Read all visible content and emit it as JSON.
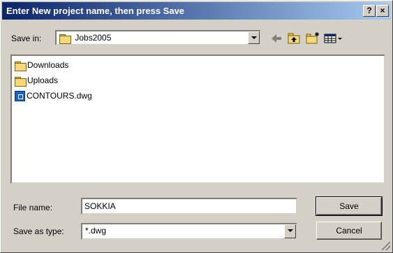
{
  "dialog": {
    "title": "Enter New project name, then press Save",
    "help_label": "?",
    "close_label": "×"
  },
  "toolbar": {
    "save_in_label": "Save in:",
    "save_in_value": "Jobs2005",
    "back_icon": "back-arrow-icon",
    "up_icon": "up-one-level-icon",
    "new_folder_icon": "new-folder-icon",
    "view_menu_icon": "view-menu-icon"
  },
  "files": [
    {
      "name": "Downloads",
      "type": "folder"
    },
    {
      "name": "Uploads",
      "type": "folder"
    },
    {
      "name": "CONTOURS.dwg",
      "type": "dwg"
    }
  ],
  "form": {
    "file_name_label": "File name:",
    "file_name_value": "SOKKIA",
    "save_as_type_label": "Save as type:",
    "save_as_type_value": "*.dwg"
  },
  "buttons": {
    "save": "Save",
    "cancel": "Cancel"
  },
  "colors": {
    "title_start": "#0a246a",
    "title_end": "#a6caf0",
    "face": "#d4d0c8"
  }
}
